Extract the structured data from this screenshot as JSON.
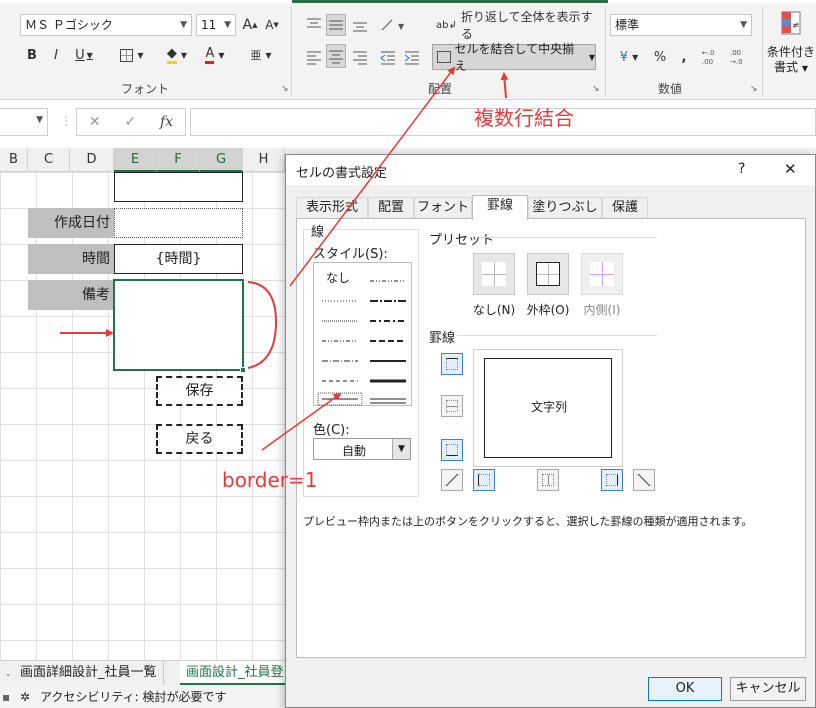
{
  "ribbon": {
    "font_name": "ＭＳ Ｐゴシック",
    "font_size": "11",
    "grow_font": "A",
    "shrink_font": "A",
    "bold": "B",
    "italic": "I",
    "underline": "U",
    "font_color_letter": "A",
    "phonetic": "亜",
    "font_group_label": "フォント",
    "wrap_text": "折り返して全体を表示する",
    "merge_center": "セルを結合して中央揃え",
    "alignment_group_label": "配置",
    "number_format": "標準",
    "currency": "¥",
    "percent": "%",
    "comma": ",",
    "number_group_label": "数値",
    "conditional_format_line1": "条件付き",
    "conditional_format_line2": "書式"
  },
  "formula_bar": {
    "cancel": "✕",
    "enter": "✓",
    "function": "fx"
  },
  "sheet": {
    "columns": [
      "B",
      "C",
      "D",
      "E",
      "F",
      "G",
      "H"
    ],
    "labels": {
      "created_date": "作成日付",
      "time": "時間",
      "note": "備考"
    },
    "time_value": "{時間}",
    "save_button": "保存",
    "back_button": "戻る",
    "tabs": [
      "画面詳細設計_社員一覧",
      "画面設計_社員登"
    ],
    "tab_scroll": ".",
    "status": "アクセシビリティ: 検討が必要です"
  },
  "annotations": {
    "merge_note": "複数行結合",
    "border_note": "border=1"
  },
  "dialog": {
    "title": "セルの書式設定",
    "help": "?",
    "close": "✕",
    "tabs": [
      "表示形式",
      "配置",
      "フォント",
      "罫線",
      "塗りつぶし",
      "保護"
    ],
    "active_tab": "罫線",
    "line_group": "線",
    "style_label": "スタイル(S):",
    "style_none": "なし",
    "color_label": "色(C):",
    "color_value": "自動",
    "preset_group": "プリセット",
    "presets": [
      "なし(N)",
      "外枠(O)",
      "内側(I)"
    ],
    "border_group": "罫線",
    "preview_text": "文字列",
    "hint": "プレビュー枠内または上のボタンをクリックすると、選択した罫線の種類が適用されます。",
    "ok": "OK",
    "cancel": "キャンセル"
  },
  "colors": {
    "excel_green": "#217346",
    "annotation_red": "#e83a3a",
    "label_cell_gray": "#bfbfbf",
    "dialog_bg": "#f0f0f0"
  }
}
